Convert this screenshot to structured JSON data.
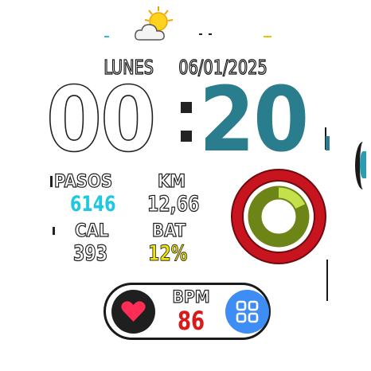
{
  "date": {
    "day": "LUNES",
    "date": "06/01/2025"
  },
  "time": {
    "hours": "00",
    "minutes": "20"
  },
  "stats": {
    "steps": {
      "label": "PASOS",
      "value": "6146",
      "color": "#1fc7e0"
    },
    "distance": {
      "label": "KM",
      "value": "12,66",
      "color": "#ffffff"
    },
    "calories": {
      "label": "CAL",
      "value": "393",
      "color": "#ffffff"
    },
    "battery": {
      "label": "BAT",
      "value": "12%",
      "color": "#f2e600"
    }
  },
  "heart_rate": {
    "label": "BPM",
    "value": "86",
    "color": "#d81b1b"
  },
  "rings": {
    "outer": {
      "progress": 1.0,
      "color": "#b8111b"
    },
    "inner": {
      "progress": 0.18,
      "color": "#7a8f1a",
      "highlight": "#c4e04a"
    }
  },
  "icons": {
    "weather": "partly-cloudy-icon",
    "heart": "heart-icon",
    "apps": "apps-grid-icon"
  },
  "colors": {
    "accent": "#2a7d8c",
    "apps_button": "#3d8df5"
  }
}
